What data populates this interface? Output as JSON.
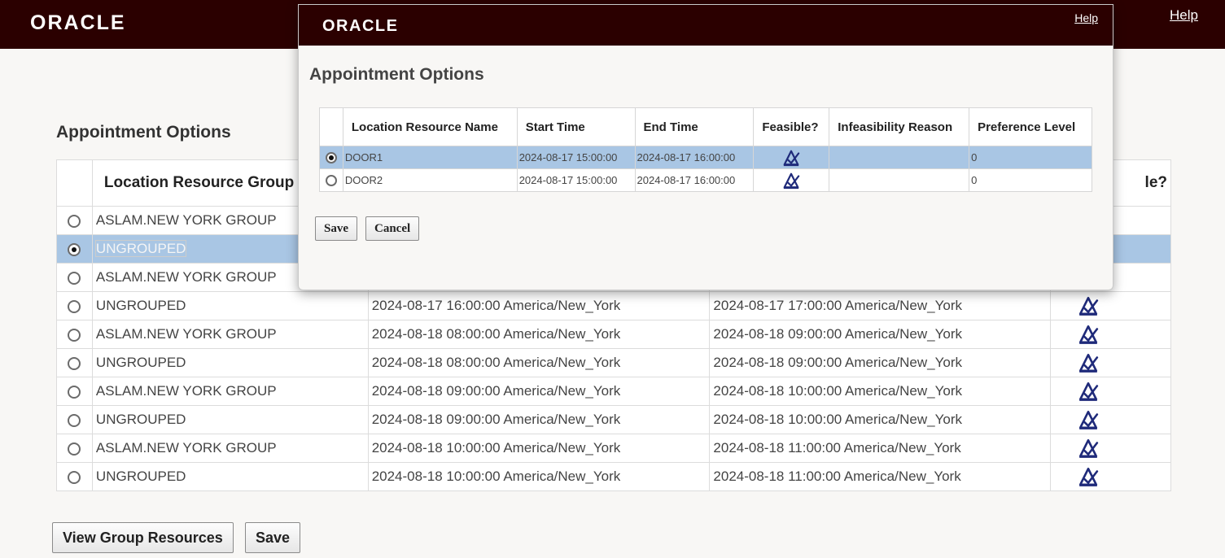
{
  "header": {
    "logo": "ORACLE",
    "help": "Help"
  },
  "page": {
    "title": "Appointment Options",
    "columns": [
      "",
      "Location Resource Group",
      "",
      "",
      "le?"
    ],
    "rows": [
      {
        "group": "ASLAM.NEW YORK GROUP",
        "start": "",
        "end": "",
        "selected": false
      },
      {
        "group": "UNGROUPED",
        "start": "",
        "end": "",
        "selected": true
      },
      {
        "group": "ASLAM.NEW YORK GROUP",
        "start": "",
        "end": "",
        "selected": false
      },
      {
        "group": "UNGROUPED",
        "start": "2024-08-17 16:00:00 America/New_York",
        "end": "2024-08-17 17:00:00 America/New_York",
        "selected": false
      },
      {
        "group": "ASLAM.NEW YORK GROUP",
        "start": "2024-08-18 08:00:00 America/New_York",
        "end": "2024-08-18 09:00:00 America/New_York",
        "selected": false
      },
      {
        "group": "UNGROUPED",
        "start": "2024-08-18 08:00:00 America/New_York",
        "end": "2024-08-18 09:00:00 America/New_York",
        "selected": false
      },
      {
        "group": "ASLAM.NEW YORK GROUP",
        "start": "2024-08-18 09:00:00 America/New_York",
        "end": "2024-08-18 10:00:00 America/New_York",
        "selected": false
      },
      {
        "group": "UNGROUPED",
        "start": "2024-08-18 09:00:00 America/New_York",
        "end": "2024-08-18 10:00:00 America/New_York",
        "selected": false
      },
      {
        "group": "ASLAM.NEW YORK GROUP",
        "start": "2024-08-18 10:00:00 America/New_York",
        "end": "2024-08-18 11:00:00 America/New_York",
        "selected": false
      },
      {
        "group": "UNGROUPED",
        "start": "2024-08-18 10:00:00 America/New_York",
        "end": "2024-08-18 11:00:00 America/New_York",
        "selected": false
      }
    ],
    "buttons": {
      "view_group_resources": "View Group Resources",
      "save": "Save"
    }
  },
  "dialog": {
    "logo": "ORACLE",
    "help": "Help",
    "title": "Appointment Options",
    "columns": [
      "",
      "Location Resource Name",
      "Start Time",
      "End Time",
      "Feasible?",
      "Infeasibility Reason",
      "Preference Level"
    ],
    "rows": [
      {
        "name": "DOOR1",
        "start": "2024-08-17 15:00:00",
        "end": "2024-08-17 16:00:00",
        "reason": "",
        "preference": "0",
        "selected": true
      },
      {
        "name": "DOOR2",
        "start": "2024-08-17 15:00:00",
        "end": "2024-08-17 16:00:00",
        "reason": "",
        "preference": "0",
        "selected": false
      }
    ],
    "buttons": {
      "save": "Save",
      "cancel": "Cancel"
    }
  },
  "colors": {
    "header_bg": "#2b0000",
    "selected_row": "#a9c6e4",
    "feasible_icon": "#1f2a7a"
  },
  "icons": {
    "feasible": "feasible-icon"
  }
}
